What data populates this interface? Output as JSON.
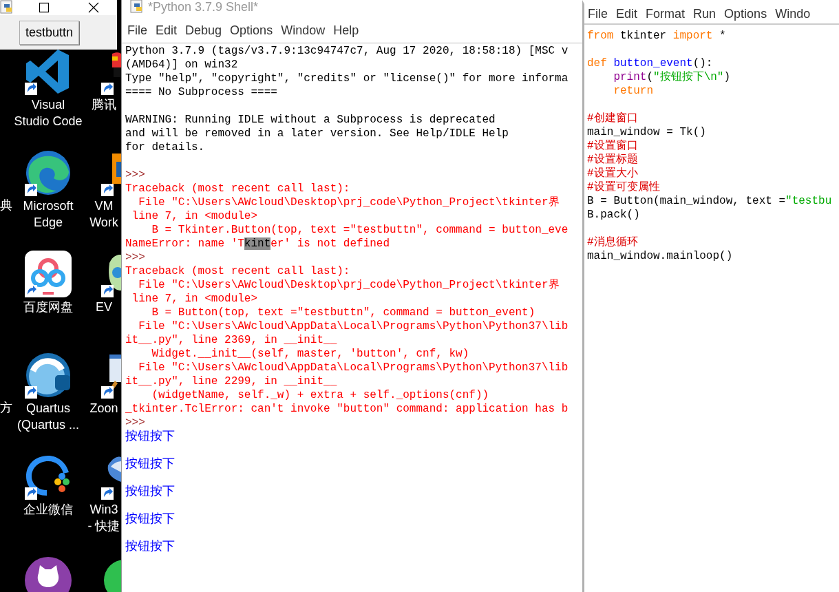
{
  "tk_window": {
    "button": "testbuttn"
  },
  "desktop": {
    "column_1": [
      {
        "kind": "vscode",
        "lines": [
          "Visual",
          "Studio Code"
        ]
      },
      {
        "kind": "edge",
        "lines": [
          "Microsoft",
          "Edge"
        ]
      },
      {
        "kind": "baidu",
        "lines": [
          "百度网盘"
        ]
      },
      {
        "kind": "quartus",
        "lines": [
          "Quartus",
          "(Quartus ..."
        ]
      },
      {
        "kind": "wecom",
        "lines": [
          "企业微信"
        ]
      },
      {
        "kind": "github"
      }
    ],
    "column_2": [
      {
        "kind": "penguin",
        "lines": [
          "腾讯"
        ]
      },
      {
        "kind": "vm",
        "lines": [
          "VM",
          "Work"
        ]
      },
      {
        "kind": "ev",
        "lines": [
          "EV"
        ]
      },
      {
        "kind": "zoom",
        "lines": [
          "Zoon"
        ]
      },
      {
        "kind": "win3",
        "lines": [
          "Win3",
          "- 快捷"
        ]
      },
      {
        "kind": "chat"
      }
    ],
    "edge_labels": [
      "典",
      "方"
    ]
  },
  "shell": {
    "title": "*Python 3.7.9 Shell*",
    "menu": [
      "File",
      "Edit",
      "Debug",
      "Options",
      "Window",
      "Help"
    ],
    "lines": [
      {
        "kind": "output",
        "text": "Python 3.7.9 (tags/v3.7.9:13c94747c7, Aug 17 2020, 18:58:18) [MSC v"
      },
      {
        "kind": "output",
        "text": "(AMD64)] on win32"
      },
      {
        "kind": "output",
        "text": "Type \"help\", \"copyright\", \"credits\" or \"license()\" for more informa"
      },
      {
        "kind": "output",
        "text": "==== No Subprocess ===="
      },
      {
        "kind": "blank"
      },
      {
        "kind": "output",
        "text": "WARNING: Running IDLE without a Subprocess is deprecated"
      },
      {
        "kind": "output",
        "text": "and will be removed in a later version. See Help/IDLE Help"
      },
      {
        "kind": "output",
        "text": "for details."
      },
      {
        "kind": "blank"
      },
      {
        "kind": "prompt",
        "text": ">>>"
      },
      {
        "kind": "error",
        "text": "Traceback (most recent call last):"
      },
      {
        "kind": "error",
        "text": "  File \"C:\\Users\\AWcloud\\Desktop\\prj_code\\Python_Project\\tkinter界"
      },
      {
        "kind": "error",
        "text": " line 7, in <module>"
      },
      {
        "kind": "error",
        "text": "    B = Tkinter.Button(top, text =\"testbuttn\", command = button_eve"
      },
      {
        "kind": "error",
        "parts": [
          {
            "text": "NameError: name 'T",
            "selected": false
          },
          {
            "text": "kint",
            "selected": true
          },
          {
            "text": "er' is not defined",
            "selected": false
          }
        ]
      },
      {
        "kind": "prompt",
        "text": ">>>"
      },
      {
        "kind": "error",
        "text": "Traceback (most recent call last):"
      },
      {
        "kind": "error",
        "text": "  File \"C:\\Users\\AWcloud\\Desktop\\prj_code\\Python_Project\\tkinter界"
      },
      {
        "kind": "error",
        "text": " line 7, in <module>"
      },
      {
        "kind": "error",
        "text": "    B = Button(top, text =\"testbuttn\", command = button_event)"
      },
      {
        "kind": "error",
        "text": "  File \"C:\\Users\\AWcloud\\AppData\\Local\\Programs\\Python\\Python37\\lib"
      },
      {
        "kind": "error",
        "text": "it__.py\", line 2369, in __init__"
      },
      {
        "kind": "error",
        "text": "    Widget.__init__(self, master, 'button', cnf, kw)"
      },
      {
        "kind": "error",
        "text": "  File \"C:\\Users\\AWcloud\\AppData\\Local\\Programs\\Python\\Python37\\lib"
      },
      {
        "kind": "error",
        "text": "it__.py\", line 2299, in __init__"
      },
      {
        "kind": "error",
        "text": "    (widgetName, self._w) + extra + self._options(cnf))"
      },
      {
        "kind": "error",
        "text": "_tkinter.TclError: can't invoke \"button\" command: application has b"
      },
      {
        "kind": "prompt",
        "text": ">>>"
      },
      {
        "kind": "stdout",
        "text": "按钮按下"
      },
      {
        "kind": "blank"
      },
      {
        "kind": "stdout",
        "text": "按钮按下"
      },
      {
        "kind": "blank"
      },
      {
        "kind": "stdout",
        "text": "按钮按下"
      },
      {
        "kind": "blank"
      },
      {
        "kind": "stdout",
        "text": "按钮按下"
      },
      {
        "kind": "blank"
      },
      {
        "kind": "stdout",
        "text": "按钮按下"
      }
    ]
  },
  "editor": {
    "menu": [
      "File",
      "Edit",
      "Format",
      "Run",
      "Options",
      "Windo"
    ],
    "lines": [
      {
        "kind": "code",
        "indented": false,
        "tokens": [
          {
            "kind": "keyword",
            "text": "from"
          },
          {
            "kind": "plain",
            "text": " tkinter "
          },
          {
            "kind": "keyword",
            "text": "import"
          },
          {
            "kind": "plain",
            "text": " *"
          }
        ]
      },
      {
        "kind": "blank"
      },
      {
        "kind": "code",
        "indented": false,
        "tokens": [
          {
            "kind": "keyword",
            "text": "def"
          },
          {
            "kind": "name",
            "text": " button_event"
          },
          {
            "kind": "plain",
            "text": "():"
          }
        ]
      },
      {
        "kind": "code",
        "indented": true,
        "tokens": [
          {
            "kind": "builtin",
            "text": "print"
          },
          {
            "kind": "plain",
            "text": "("
          },
          {
            "kind": "string",
            "text": "\"按钮按下\\n\""
          },
          {
            "kind": "plain",
            "text": ")"
          }
        ]
      },
      {
        "kind": "code",
        "indented": true,
        "tokens": [
          {
            "kind": "keyword",
            "text": "return"
          }
        ]
      },
      {
        "kind": "blank"
      },
      {
        "kind": "code",
        "indented": false,
        "tokens": [
          {
            "kind": "comment",
            "text": "#创建窗口"
          }
        ]
      },
      {
        "kind": "code",
        "indented": false,
        "tokens": [
          {
            "kind": "plain",
            "text": "main_window = Tk()"
          }
        ]
      },
      {
        "kind": "code",
        "indented": false,
        "tokens": [
          {
            "kind": "comment",
            "text": "#设置窗口"
          }
        ]
      },
      {
        "kind": "code",
        "indented": false,
        "tokens": [
          {
            "kind": "comment",
            "text": "#设置标题"
          }
        ]
      },
      {
        "kind": "code",
        "indented": false,
        "tokens": [
          {
            "kind": "comment",
            "text": "#设置大小"
          }
        ]
      },
      {
        "kind": "code",
        "indented": false,
        "tokens": [
          {
            "kind": "comment",
            "text": "#设置可变属性"
          }
        ]
      },
      {
        "kind": "code",
        "indented": false,
        "tokens": [
          {
            "kind": "plain",
            "text": "B = Button(main_window, text ="
          },
          {
            "kind": "string",
            "text": "\"testbu"
          }
        ]
      },
      {
        "kind": "code",
        "indented": false,
        "tokens": [
          {
            "kind": "plain",
            "text": "B.pack()"
          }
        ]
      },
      {
        "kind": "blank"
      },
      {
        "kind": "code",
        "indented": false,
        "tokens": [
          {
            "kind": "comment",
            "text": "#消息循环"
          }
        ]
      },
      {
        "kind": "code",
        "indented": false,
        "tokens": [
          {
            "kind": "plain",
            "text": "main_window.mainloop()"
          }
        ]
      }
    ]
  }
}
